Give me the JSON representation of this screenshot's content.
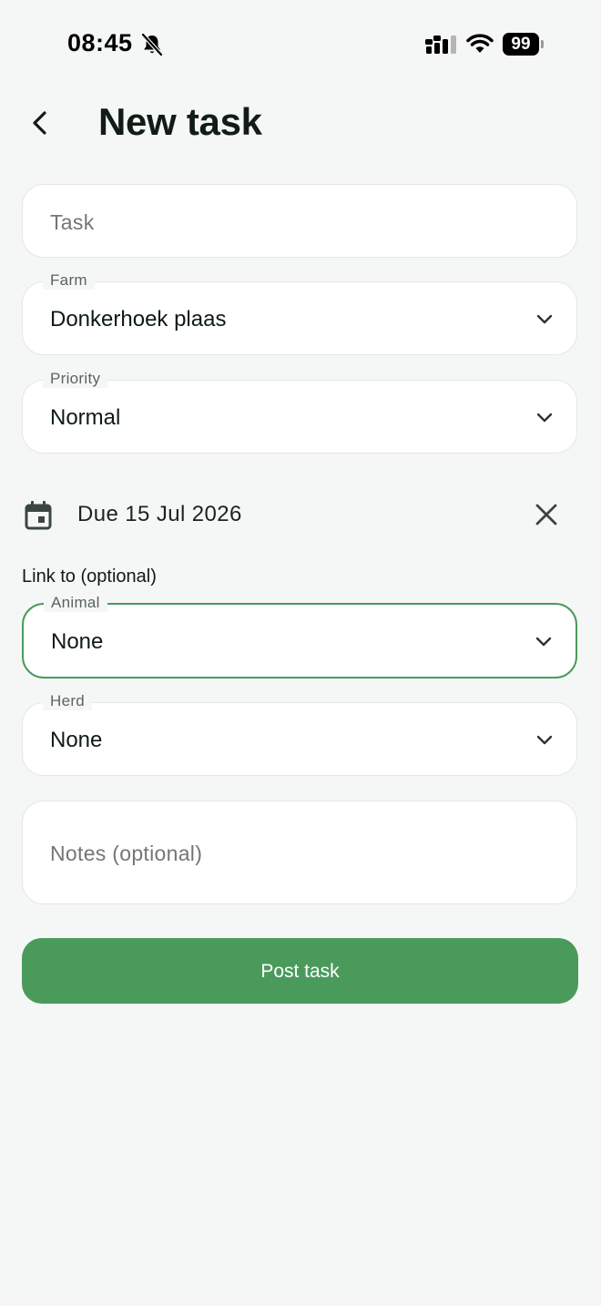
{
  "status_bar": {
    "time": "08:45",
    "battery_level": "99",
    "icons": [
      "bell-off-icon",
      "signal-icon",
      "wifi-icon",
      "battery-icon"
    ]
  },
  "header": {
    "title": "New task",
    "back_icon": "chevron-left-icon"
  },
  "form": {
    "task": {
      "placeholder": "Task",
      "value": ""
    },
    "farm": {
      "label": "Farm",
      "value": "Donkerhoek plaas"
    },
    "priority": {
      "label": "Priority",
      "value": "Normal"
    },
    "due": {
      "text": "Due 15 Jul 2026",
      "icon": "calendar-icon",
      "clear_icon": "close-icon"
    },
    "link_section_label": "Link to (optional)",
    "animal": {
      "label": "Animal",
      "value": "None"
    },
    "herd": {
      "label": "Herd",
      "value": "None"
    },
    "notes": {
      "placeholder": "Notes (optional)",
      "value": ""
    },
    "submit_label": "Post task"
  },
  "colors": {
    "background": "#f5f7f6",
    "field_background": "#ffffff",
    "field_border": "#e4e8e5",
    "accent": "#4a9a5c",
    "text_primary": "#0f1a14",
    "text_secondary": "#59645e"
  }
}
